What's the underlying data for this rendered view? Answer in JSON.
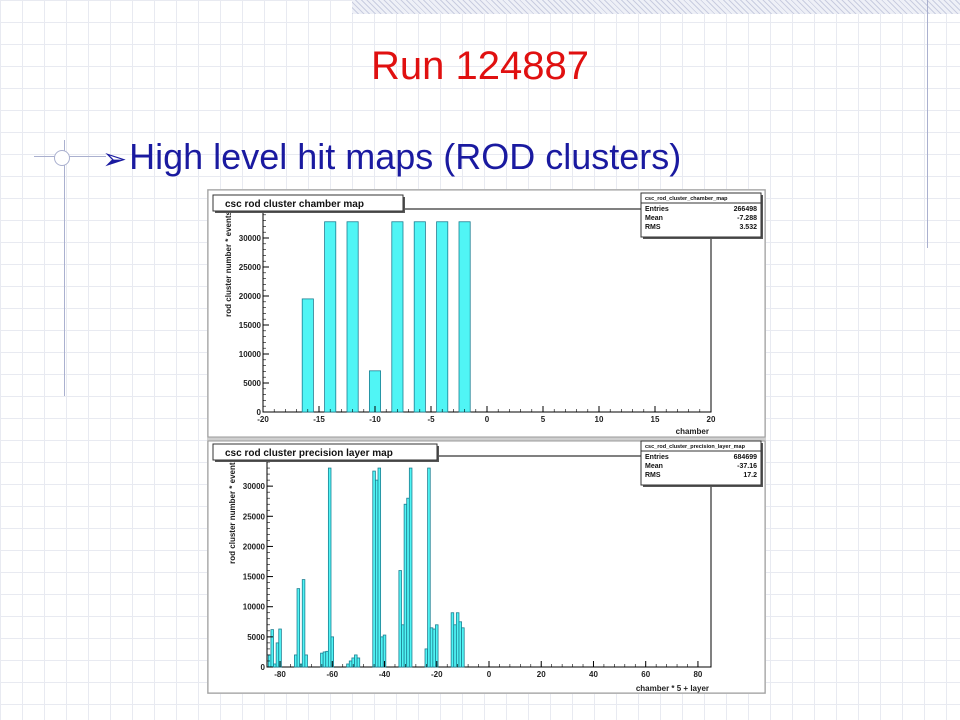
{
  "slide": {
    "title": "Run 124887",
    "bullet_arrow": "➢",
    "bullet_text": "High level hit maps (ROD clusters)"
  },
  "colors": {
    "title": "#e01010",
    "bullet": "#1a1aa0",
    "bar_fill": "#50f5f5",
    "bar_stroke": "#1c7f92"
  },
  "chart_data": [
    {
      "type": "bar",
      "title": "csc rod cluster chamber map",
      "stats": {
        "name": "csc_rod_cluster_chamber_map",
        "rows": [
          {
            "label": "Entries",
            "value": "266498"
          },
          {
            "label": "Mean",
            "value": "-7.288"
          },
          {
            "label": "RMS",
            "value": "3.532"
          }
        ]
      },
      "xlabel": "chamber",
      "ylabel": "rod cluster number * events",
      "xlim": [
        -20,
        20
      ],
      "ylim": [
        0,
        35000
      ],
      "xticks": [
        -20,
        -15,
        -10,
        -5,
        0,
        5,
        10,
        15,
        20
      ],
      "yticks": [
        0,
        5000,
        10000,
        15000,
        20000,
        25000,
        30000
      ],
      "bar_width": 1,
      "bars": [
        {
          "x": -16,
          "value": 19500
        },
        {
          "x": -14,
          "value": 32800
        },
        {
          "x": -12,
          "value": 32800
        },
        {
          "x": -10,
          "value": 7100
        },
        {
          "x": -8,
          "value": 32800
        },
        {
          "x": -6,
          "value": 32800
        },
        {
          "x": -4,
          "value": 32800
        },
        {
          "x": -2,
          "value": 32800
        }
      ]
    },
    {
      "type": "bar",
      "title": "csc rod cluster precision layer map",
      "stats": {
        "name": "csc_rod_cluster_precision_layer_map",
        "rows": [
          {
            "label": "Entries",
            "value": "684699"
          },
          {
            "label": "Mean",
            "value": "-37.16"
          },
          {
            "label": "RMS",
            "value": "17.2"
          }
        ]
      },
      "xlabel": "chamber * 5 + layer",
      "ylabel": "rod cluster number * events",
      "xlim": [
        -85,
        85
      ],
      "ylim": [
        0,
        35000
      ],
      "xticks": [
        -80,
        -60,
        -40,
        -20,
        0,
        20,
        40,
        60,
        80
      ],
      "yticks": [
        0,
        5000,
        10000,
        15000,
        20000,
        25000,
        30000
      ],
      "bar_width": 1,
      "bars": [
        {
          "x": -84,
          "value": 2000
        },
        {
          "x": -83,
          "value": 6200
        },
        {
          "x": -82,
          "value": 500
        },
        {
          "x": -81,
          "value": 4000
        },
        {
          "x": -80,
          "value": 6300
        },
        {
          "x": -74,
          "value": 2000
        },
        {
          "x": -73,
          "value": 13000
        },
        {
          "x": -72,
          "value": 500
        },
        {
          "x": -71,
          "value": 14500
        },
        {
          "x": -70,
          "value": 2000
        },
        {
          "x": -64,
          "value": 2300
        },
        {
          "x": -63,
          "value": 2500
        },
        {
          "x": -62,
          "value": 2600
        },
        {
          "x": -61,
          "value": 33000
        },
        {
          "x": -60,
          "value": 5000
        },
        {
          "x": -54,
          "value": 500
        },
        {
          "x": -53,
          "value": 1000
        },
        {
          "x": -52,
          "value": 1500
        },
        {
          "x": -51,
          "value": 2000
        },
        {
          "x": -50,
          "value": 1500
        },
        {
          "x": -44,
          "value": 32500
        },
        {
          "x": -43,
          "value": 31000
        },
        {
          "x": -42,
          "value": 33000
        },
        {
          "x": -41,
          "value": 5000
        },
        {
          "x": -40,
          "value": 5300
        },
        {
          "x": -34,
          "value": 16000
        },
        {
          "x": -33,
          "value": 7000
        },
        {
          "x": -32,
          "value": 27000
        },
        {
          "x": -31,
          "value": 28000
        },
        {
          "x": -30,
          "value": 33000
        },
        {
          "x": -24,
          "value": 3000
        },
        {
          "x": -23,
          "value": 33000
        },
        {
          "x": -22,
          "value": 6500
        },
        {
          "x": -21,
          "value": 6300
        },
        {
          "x": -20,
          "value": 7000
        },
        {
          "x": -14,
          "value": 9000
        },
        {
          "x": -13,
          "value": 7000
        },
        {
          "x": -12,
          "value": 9000
        },
        {
          "x": -11,
          "value": 7500
        },
        {
          "x": -10,
          "value": 6500
        }
      ]
    }
  ]
}
